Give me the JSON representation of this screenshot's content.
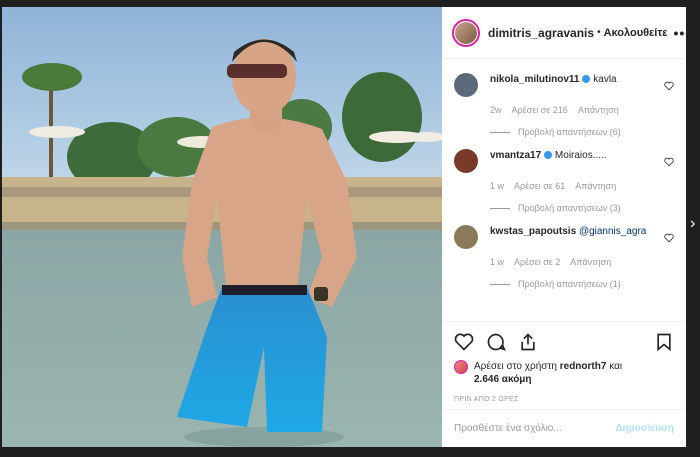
{
  "post": {
    "username": "dimitris_agravanis",
    "follow_label": "Ακολουθείτε",
    "dot": "•",
    "more": "•••"
  },
  "comments": [
    {
      "username": "nikola_milutinov11",
      "verified": true,
      "text": "kavla",
      "mention": "",
      "age": "2w",
      "likes": "Αρέσει σε 216",
      "reply": "Απάντηση",
      "view_replies": "Προβολή απαντήσεων (6)",
      "avatar_color": "#5a6a7a"
    },
    {
      "username": "vmantza17",
      "verified": true,
      "text": "Moiraios.....",
      "mention": "",
      "age": "1 w",
      "likes": "Αρέσει σε 61",
      "reply": "Απάντηση",
      "view_replies": "Προβολή απαντήσεων (3)",
      "avatar_color": "#7a3a2a"
    },
    {
      "username": "kwstas_papoutsis",
      "verified": false,
      "text": "",
      "mention": "@giannis_agra",
      "age": "1 w",
      "likes": "Αρέσει σε 2",
      "reply": "Απάντηση",
      "view_replies": "Προβολή απαντήσεων (1)",
      "avatar_color": "#8a7a5a"
    }
  ],
  "actions": {
    "liked_by_prefix": "Αρέσει στο χρήστη",
    "liked_by_user": "rednorth7",
    "liked_by_and": "και",
    "others": "2.646 ακόμη",
    "timestamp": "ΠΡΙΝ ΑΠΟ 2 ΩΡΕΣ"
  },
  "composer": {
    "placeholder": "Προσθέστε ένα σχόλιο...",
    "post_label": "Δημοσίευση"
  },
  "colors": {
    "accent_blue": "#3897f0",
    "post_disabled": "#b2dffc",
    "story_ring": "#d6249f"
  },
  "icons": [
    "heart-icon",
    "comment-icon",
    "share-icon",
    "bookmark-icon",
    "verified-icon",
    "chevron-right-icon"
  ]
}
